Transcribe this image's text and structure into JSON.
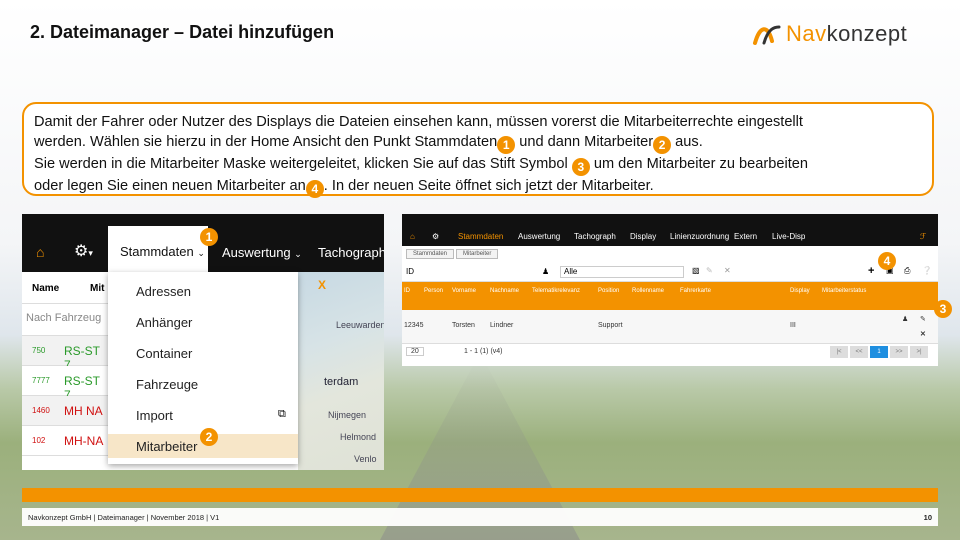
{
  "header": {
    "title": "2. Dateimanager – Datei hinzufügen",
    "logo_nav": "Nav",
    "logo_rest": "konzept"
  },
  "callout": {
    "line1": "Damit der Fahrer oder Nutzer des Displays die Dateien einsehen kann, müssen vorerst die Mitarbeiterrechte eingestellt",
    "line2a": "werden. Wählen sie hierzu in der Home Ansicht den Punkt Stammdaten",
    "line2b": " und dann Mitarbeiter",
    "line2c": " aus.",
    "line3a": "Sie werden in die Mitarbeiter Maske weitergeleitet, klicken Sie auf das Stift Symbol ",
    "line3b": " um den Mitarbeiter zu bearbeiten",
    "line4a": "oder legen Sie einen neuen Mitarbeiter an",
    "line4b": ". In der neuen Seite öffnet sich jetzt der Mitarbeiter.",
    "badges": [
      "1",
      "2",
      "3",
      "4"
    ]
  },
  "left_shot": {
    "menu": [
      "Stammdaten",
      "Auswertung",
      "Tachograph"
    ],
    "col_name": "Name",
    "col_mit": "Mit",
    "search_placeholder": "Nach Fahrzeug",
    "rows": [
      {
        "id": "750",
        "plate": "RS-ST 7",
        "color": "#2a9a2a"
      },
      {
        "id": "7777",
        "plate": "RS-ST 7",
        "color": "#2a9a2a"
      },
      {
        "id": "1460",
        "plate": "MH NA",
        "color": "#d01010"
      },
      {
        "id": "102",
        "plate": "MH-NA",
        "color": "#d01010"
      }
    ],
    "dropdown": [
      "Adressen",
      "Anhänger",
      "Container",
      "Fahrzeuge",
      "Import",
      "Mitarbeiter"
    ],
    "map_labels": [
      "Leeuwarden",
      "terdam",
      "Nijmegen",
      "Helmond",
      "Venlo"
    ],
    "map_close": "X"
  },
  "right_shot": {
    "menu": [
      "Stammdaten",
      "Auswertung",
      "Tachograph",
      "Display",
      "Linienzuordnung",
      "Extern",
      "Live-Disp"
    ],
    "crumbs": [
      "Stammdaten",
      "Mitarbeiter"
    ],
    "filter_value": "Alle",
    "filter_label": "ID",
    "headers": [
      "ID",
      "Person",
      "Vorname",
      "Nachname",
      "Telematikrelevanz",
      "Position",
      "Rollenname",
      "Fahrerkarte",
      "Display",
      "Mitarbeiterstatus"
    ],
    "row": {
      "id": "12345",
      "vorname": "Torsten",
      "nachname": "Lindner",
      "position": "Support",
      "display": "III"
    },
    "page_size": "20",
    "page_info": "1 - 1 (1) (v4)",
    "pager": [
      "|<",
      "<<",
      "1",
      ">>",
      ">|"
    ]
  },
  "footer": {
    "text": "Navkonzept GmbH  |  Dateimanager  |  November 2018  |  V1",
    "page": "10"
  },
  "colors": {
    "accent": "#f39200"
  }
}
